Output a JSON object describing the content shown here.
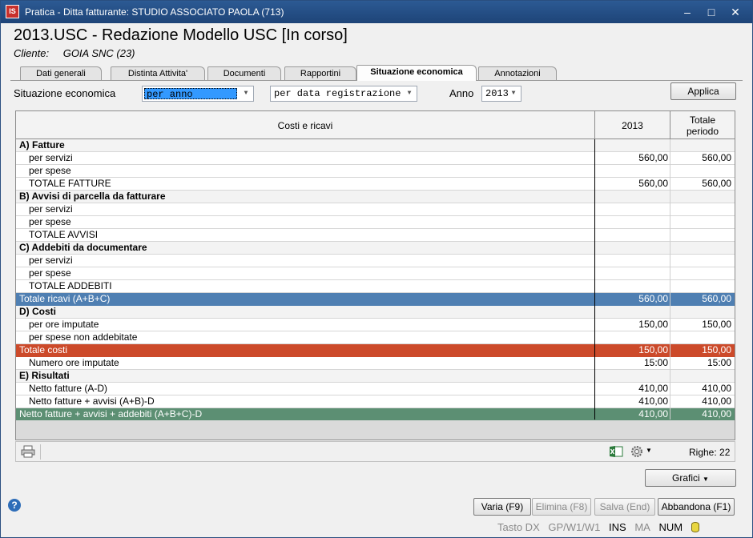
{
  "window": {
    "title": "Pratica - Ditta fatturante: STUDIO ASSOCIATO PAOLA (713)",
    "app_icon_text": "IS",
    "controls": [
      "minimize-icon",
      "maximize-icon",
      "close-icon"
    ]
  },
  "header": {
    "title": "2013.USC - Redazione Modello USC [In corso]",
    "client_label": "Cliente:",
    "client_value": "GOIA SNC (23)"
  },
  "tabs": [
    {
      "label": "Dati generali"
    },
    {
      "label": "Distinta Attivita'"
    },
    {
      "label": "Documenti"
    },
    {
      "label": "Rapportini"
    },
    {
      "label": "Situazione economica",
      "active": true
    },
    {
      "label": "Annotazioni"
    }
  ],
  "filters": {
    "label": "Situazione economica",
    "period_mode": "per anno",
    "date_mode": "per data registrazione",
    "year_label": "Anno",
    "year": "2013",
    "apply_label": "Applica"
  },
  "grid": {
    "columns": [
      "Costi e ricavi",
      "2013",
      "Totale periodo"
    ],
    "rows": [
      {
        "type": "section",
        "label": "A) Fatture",
        "y2013": "",
        "total": ""
      },
      {
        "type": "item",
        "label": "per servizi",
        "y2013": "560,00",
        "total": "560,00"
      },
      {
        "type": "item",
        "label": "per spese",
        "y2013": "",
        "total": ""
      },
      {
        "type": "item",
        "label": "TOTALE FATTURE",
        "y2013": "560,00",
        "total": "560,00"
      },
      {
        "type": "section",
        "label": "B) Avvisi di parcella da fatturare",
        "y2013": "",
        "total": ""
      },
      {
        "type": "item",
        "label": "per servizi",
        "y2013": "",
        "total": ""
      },
      {
        "type": "item",
        "label": "per spese",
        "y2013": "",
        "total": ""
      },
      {
        "type": "item",
        "label": "TOTALE AVVISI",
        "y2013": "",
        "total": ""
      },
      {
        "type": "section",
        "label": "C) Addebiti da documentare",
        "y2013": "",
        "total": ""
      },
      {
        "type": "item",
        "label": "per servizi",
        "y2013": "",
        "total": ""
      },
      {
        "type": "item",
        "label": "per spese",
        "y2013": "",
        "total": ""
      },
      {
        "type": "item",
        "label": "TOTALE ADDEBITI",
        "y2013": "",
        "total": ""
      },
      {
        "type": "total-ricavi",
        "label": "Totale ricavi (A+B+C)",
        "y2013": "560,00",
        "total": "560,00"
      },
      {
        "type": "section",
        "label": "D) Costi",
        "y2013": "",
        "total": ""
      },
      {
        "type": "item",
        "label": "per ore imputate",
        "y2013": "150,00",
        "total": "150,00"
      },
      {
        "type": "item",
        "label": "per spese non addebitate",
        "y2013": "",
        "total": ""
      },
      {
        "type": "total-costi",
        "label": "Totale costi",
        "y2013": "150,00",
        "total": "150,00"
      },
      {
        "type": "item",
        "label": "Numero ore imputate",
        "y2013": "15:00",
        "total": "15:00"
      },
      {
        "type": "section",
        "label": "E) Risultati",
        "y2013": "",
        "total": ""
      },
      {
        "type": "item",
        "label": "Netto fatture (A-D)",
        "y2013": "410,00",
        "total": "410,00"
      },
      {
        "type": "item",
        "label": "Netto fatture + avvisi (A+B)-D",
        "y2013": "410,00",
        "total": "410,00"
      },
      {
        "type": "total-netto",
        "label": "Netto fatture + avvisi + addebiti (A+B+C)-D",
        "y2013": "410,00",
        "total": "410,00"
      }
    ]
  },
  "statusbar": {
    "rows_count": "Righe: 22"
  },
  "buttons": {
    "grafici": "Grafici",
    "varia": "Varia (F9)",
    "elimina": "Elimina (F8)",
    "salva": "Salva (End)",
    "abbandona": "Abbandona (F1)"
  },
  "indicators": {
    "tasto": "Tasto DX",
    "gp": "GP/W1/W1",
    "ins": "INS",
    "ma": "MA",
    "num": "NUM"
  },
  "colors": {
    "total_ricavi": "#4f7fb2",
    "total_costi": "#cc4a2a",
    "total_netto": "#5c8f73"
  }
}
